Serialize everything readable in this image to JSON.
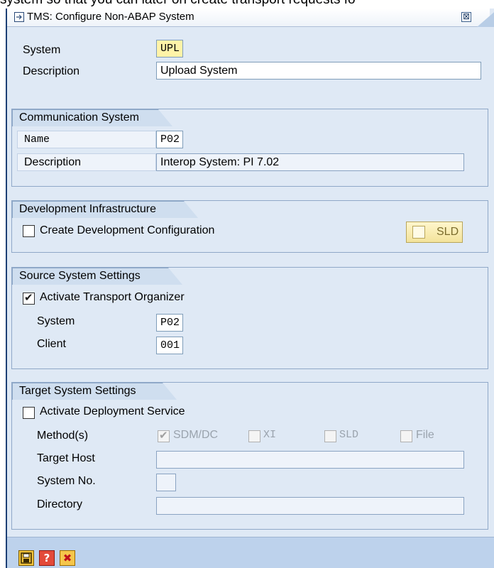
{
  "background_text": "system so that you can later on create transport requests fo",
  "window": {
    "title": "TMS: Configure Non-ABAP System",
    "close_glyph": "⊠"
  },
  "header": {
    "system_label": "System",
    "system_value": "UPL",
    "description_label": "Description",
    "description_value": "Upload System"
  },
  "communication_system": {
    "title": "Communication System",
    "name_label": "Name",
    "name_value": "P02",
    "description_label": "Description",
    "description_value": "Interop System: PI 7.02"
  },
  "development_infrastructure": {
    "title": "Development Infrastructure",
    "create_config_label": "Create Development Configuration",
    "create_config_checked": false,
    "sld_button_label": "SLD"
  },
  "source_system": {
    "title": "Source System Settings",
    "activate_label": "Activate Transport Organizer",
    "activate_checked": true,
    "system_label": "System",
    "system_value": "P02",
    "client_label": "Client",
    "client_value": "001"
  },
  "target_system": {
    "title": "Target System Settings",
    "activate_label": "Activate Deployment Service",
    "activate_checked": false,
    "method_label": "Method(s)",
    "methods": [
      {
        "label": "SDM/DC",
        "checked": true
      },
      {
        "label": "XI",
        "checked": false
      },
      {
        "label": "SLD",
        "checked": false
      },
      {
        "label": "File",
        "checked": false
      }
    ],
    "target_host_label": "Target Host",
    "target_host_value": "",
    "system_no_label": "System No.",
    "system_no_value": "",
    "directory_label": "Directory",
    "directory_value": ""
  },
  "footer": {
    "save_glyph": "▭",
    "help_glyph": "?",
    "cancel_glyph": "✖"
  },
  "check_glyph": "✔"
}
